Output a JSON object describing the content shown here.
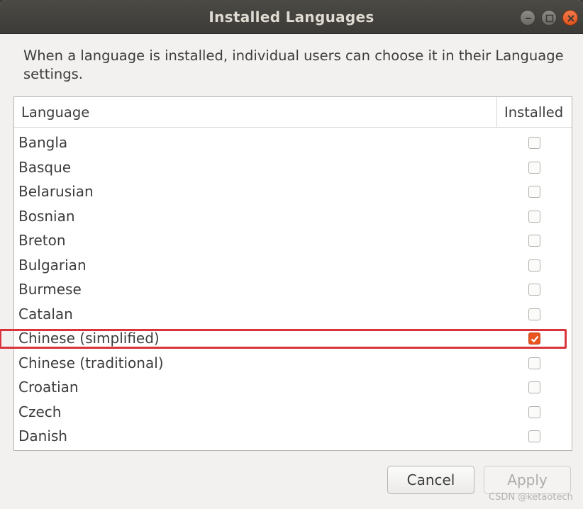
{
  "window": {
    "title": "Installed Languages"
  },
  "description": "When a language is installed, individual users can choose it in their Language settings.",
  "list": {
    "columns": {
      "language": "Language",
      "installed": "Installed"
    },
    "rows": [
      {
        "label": "Bangla",
        "installed": false
      },
      {
        "label": "Basque",
        "installed": false
      },
      {
        "label": "Belarusian",
        "installed": false
      },
      {
        "label": "Bosnian",
        "installed": false
      },
      {
        "label": "Breton",
        "installed": false
      },
      {
        "label": "Bulgarian",
        "installed": false
      },
      {
        "label": "Burmese",
        "installed": false
      },
      {
        "label": "Catalan",
        "installed": false
      },
      {
        "label": "Chinese (simplified)",
        "installed": true
      },
      {
        "label": "Chinese (traditional)",
        "installed": false
      },
      {
        "label": "Croatian",
        "installed": false
      },
      {
        "label": "Czech",
        "installed": false
      },
      {
        "label": "Danish",
        "installed": false
      }
    ]
  },
  "buttons": {
    "cancel": "Cancel",
    "apply": "Apply"
  },
  "watermark": "CSDN @ketaotech",
  "colors": {
    "accent": "#e95420",
    "highlight": "#d9343c",
    "titlebar": "#3c3b37"
  }
}
